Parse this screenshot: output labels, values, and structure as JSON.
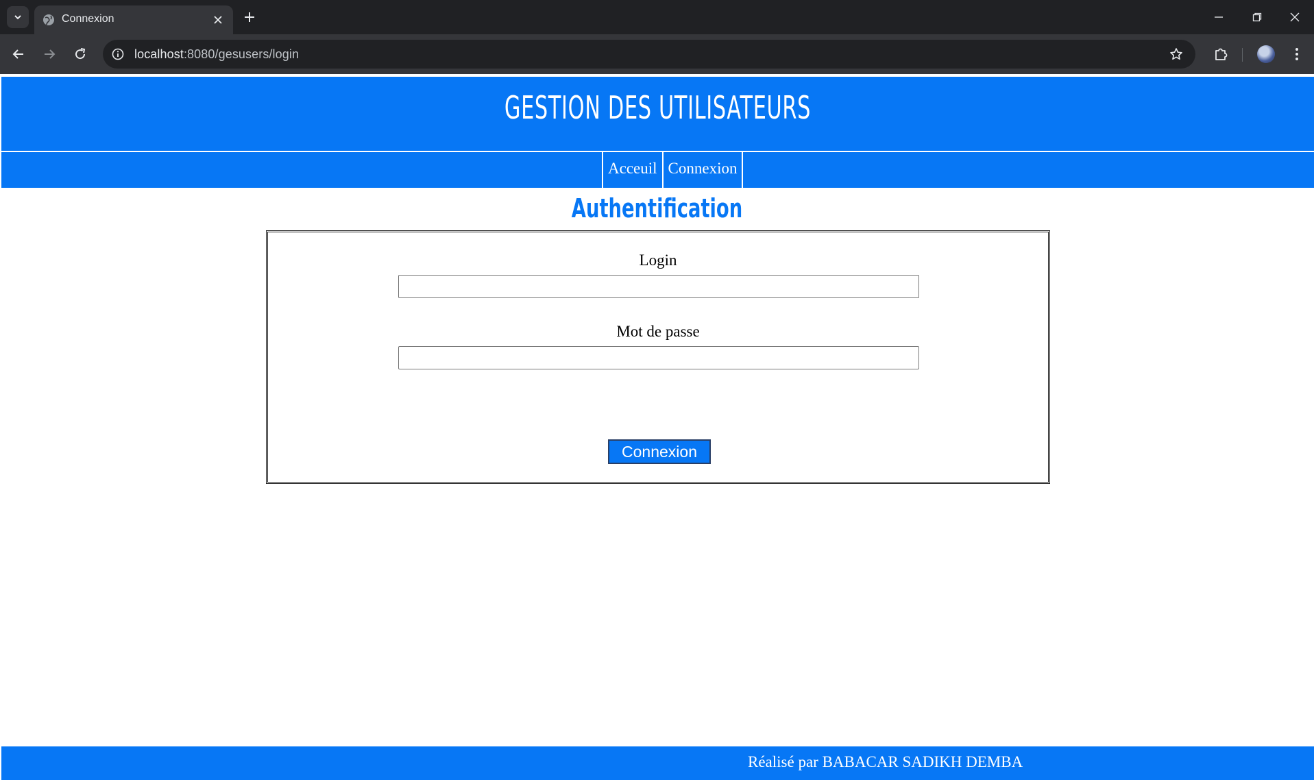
{
  "browser": {
    "tab_title": "Connexion",
    "url_host": "localhost",
    "url_path": ":8080/gesusers/login",
    "icons": {
      "tab_list": "chevron-down-icon",
      "favicon": "globe-icon",
      "tab_close": "close-icon",
      "new_tab": "plus-icon",
      "back": "arrow-left-icon",
      "forward": "arrow-right-icon",
      "reload": "reload-icon",
      "site_info": "info-icon",
      "bookmark": "star-icon",
      "extensions": "puzzle-icon",
      "profile": "avatar",
      "menu": "kebab-menu-icon",
      "minimize": "minimize-icon",
      "restore": "restore-icon",
      "close_window": "close-icon"
    }
  },
  "site": {
    "banner_title": "GESTION DES UTILISATEURS",
    "nav": [
      {
        "label": "Acceuil"
      },
      {
        "label": "Connexion"
      }
    ],
    "page_title": "Authentification",
    "form": {
      "login_label": "Login",
      "login_value": "",
      "password_label": "Mot de passe",
      "password_value": "",
      "submit_label": "Connexion"
    },
    "footer_text": "Réalisé par BABACAR SADIKH DEMBA"
  },
  "colors": {
    "primary_blue": "#0777f5",
    "chrome_dark": "#202124",
    "chrome_toolbar": "#35363a"
  }
}
